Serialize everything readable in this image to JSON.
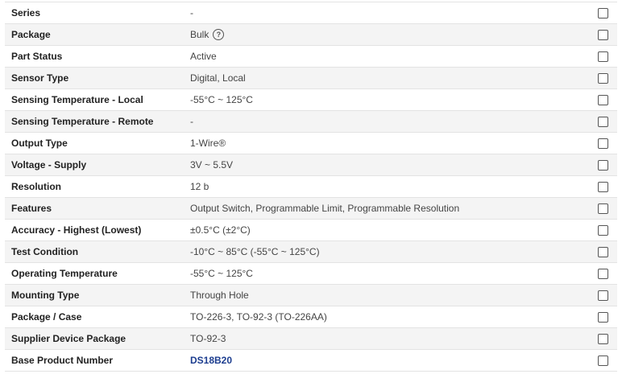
{
  "rows": [
    {
      "label": "Series",
      "value": "-"
    },
    {
      "label": "Package",
      "value": "Bulk"
    },
    {
      "label": "Part Status",
      "value": "Active"
    },
    {
      "label": "Sensor Type",
      "value": "Digital, Local"
    },
    {
      "label": "Sensing Temperature - Local",
      "value": "-55°C ~ 125°C"
    },
    {
      "label": "Sensing Temperature - Remote",
      "value": "-"
    },
    {
      "label": "Output Type",
      "value": "1-Wire®"
    },
    {
      "label": "Voltage - Supply",
      "value": "3V ~ 5.5V"
    },
    {
      "label": "Resolution",
      "value": "12 b"
    },
    {
      "label": "Features",
      "value": "Output Switch, Programmable Limit, Programmable Resolution"
    },
    {
      "label": "Accuracy - Highest (Lowest)",
      "value": "±0.5°C (±2°C)"
    },
    {
      "label": "Test Condition",
      "value": "-10°C ~ 85°C (-55°C ~ 125°C)"
    },
    {
      "label": "Operating Temperature",
      "value": "-55°C ~ 125°C"
    },
    {
      "label": "Mounting Type",
      "value": "Through Hole"
    },
    {
      "label": "Package / Case",
      "value": "TO-226-3, TO-92-3 (TO-226AA)"
    },
    {
      "label": "Supplier Device Package",
      "value": "TO-92-3"
    },
    {
      "label": "Base Product Number",
      "value": "DS18B20"
    }
  ],
  "icons": {
    "help": "?"
  },
  "colors": {
    "link": "#1c3d8f",
    "row_alt": "#f4f4f4",
    "border": "#e3e3e3"
  }
}
